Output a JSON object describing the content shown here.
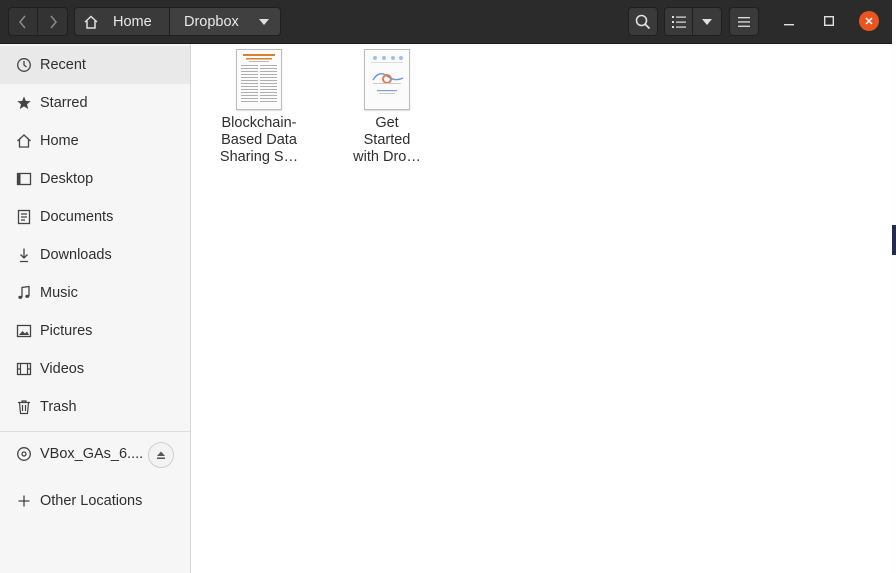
{
  "header": {
    "path": [
      {
        "label": "Home"
      },
      {
        "label": "Dropbox"
      }
    ]
  },
  "sidebar": {
    "items": [
      {
        "label": "Recent",
        "icon": "clock-icon",
        "active": true
      },
      {
        "label": "Starred",
        "icon": "star-icon"
      },
      {
        "label": "Home",
        "icon": "home-icon"
      },
      {
        "label": "Desktop",
        "icon": "desktop-icon"
      },
      {
        "label": "Documents",
        "icon": "document-icon"
      },
      {
        "label": "Downloads",
        "icon": "download-icon"
      },
      {
        "label": "Music",
        "icon": "music-icon"
      },
      {
        "label": "Pictures",
        "icon": "picture-icon"
      },
      {
        "label": "Videos",
        "icon": "video-icon"
      },
      {
        "label": "Trash",
        "icon": "trash-icon"
      }
    ],
    "device": {
      "label": "VBox_GAs_6....",
      "icon": "disc-icon"
    },
    "other": {
      "label": "Other Locations",
      "icon": "plus-icon"
    }
  },
  "files": [
    {
      "name_lines": [
        "Blockchain-",
        "Based Data",
        "Sharing S…"
      ],
      "thumb": "pdf-thumbnail"
    },
    {
      "name_lines": [
        "Get",
        "Started",
        "with Dro…"
      ],
      "thumb": "pdf-thumbnail"
    }
  ],
  "colors": {
    "headerbar": "#2b2b2b",
    "close_button": "#e9541f",
    "sidebar": "#f6f6f6"
  }
}
